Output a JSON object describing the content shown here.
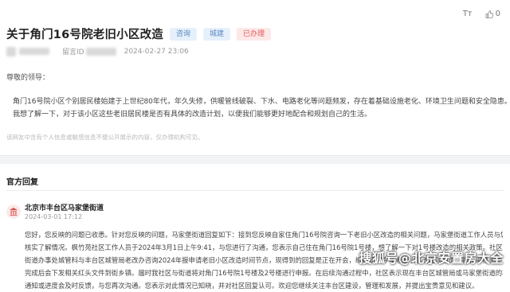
{
  "post": {
    "title": "关于角门16号院老旧小区改造",
    "tags": [
      {
        "label": "咨询",
        "color": "#5a88c4"
      },
      {
        "label": "城建",
        "color": "#5a88c4"
      },
      {
        "label": "已办理",
        "color": "#e0585b"
      }
    ],
    "toolbar": {
      "font_icon": "Tт",
      "like_count": "0"
    },
    "meta": {
      "id_label": "留言ID",
      "datetime": "2024-02-27 23:06"
    },
    "greeting": "尊敬的领导：",
    "body": [
      "角门16号院小区个别居民楼始建于上世纪80年代，年久失修，供暖管线破裂、下水、电路老化等问题频发，存在着基础设施老化、环境卫生问题和安全隐患。",
      "我想了解一下，对于该小区这些老旧居民楼是否有具体的改造计划，以便我们能够更好地配合和规划自己的生活。"
    ],
    "disclaimer": "该网友中含有个人信息或敏感信息不便公开展示的内容，仅办理机构可见。"
  },
  "reply": {
    "section_title": "官方回复",
    "org_name": "北京市丰台区马家堡街道",
    "date": "2024-03-01 17:12",
    "lines": [
      "您好，您反映的问题已收悉。针对您反映的问题，马家堡街道回复如下：接到您反映自家住角门16号院咨询一下老旧小区改造的相关问题，马家堡街道工作人员与您联系沟通",
      "核实了解情况。枫竹苑社区工作人员于2024年3月1日上午9:41，与您进行了沟通，您表示自己住在角门16号院1号楼，想了解一下对1号楼改造的相关政策。社区分别咨询了",
      "街道办事处城管科与丰台区城管局老改办咨询2024年报申请老旧小区改造时间节点，现得到的回复是正在开会，继续研究今年老旧小区改造项目的审批和审核条件，待审核",
      "完成后会下发相关红头文件到街乡镇。届时我社区与街道将对角门16号院1号楼及2号楼进行申报。在后续沟通过程中，社区表示现在丰台区城管局或马家堡街道的相关",
      "通知或进度会及时反馈，与您再次沟通。您表示对此情况已知晓，并对社区回复认可。欢迎您继续关注丰台区建设，管理和发展，并提出宝贵意见和建议。"
    ]
  },
  "watermark": "搜狐号@北京安置房大全"
}
